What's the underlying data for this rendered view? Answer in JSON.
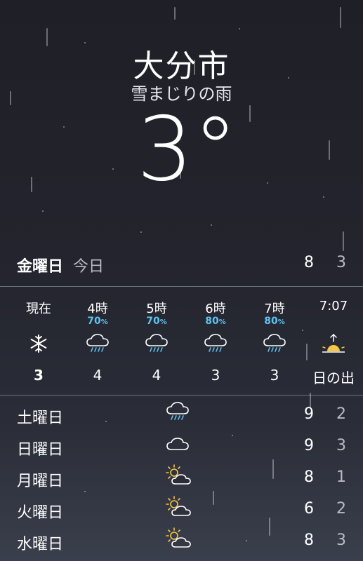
{
  "location": {
    "city": "大分市",
    "condition": "雪まじりの雨",
    "temperature": "3°"
  },
  "today": {
    "day": "金曜日",
    "label": "今日",
    "high": "8",
    "low": "3"
  },
  "hourly": [
    {
      "time": "現在",
      "precip": "",
      "icon": "snowflake-icon",
      "value": "3"
    },
    {
      "time": "4時",
      "precip": "70",
      "icon": "rain-cloud-icon",
      "value": "4"
    },
    {
      "time": "5時",
      "precip": "70",
      "icon": "rain-cloud-icon",
      "value": "4"
    },
    {
      "time": "6時",
      "precip": "80",
      "icon": "rain-cloud-icon",
      "value": "3"
    },
    {
      "time": "7時",
      "precip": "80",
      "icon": "rain-cloud-icon",
      "value": "3"
    },
    {
      "time": "7:07",
      "precip": "",
      "icon": "sunrise-icon",
      "value": "日の出"
    }
  ],
  "precip_unit": "%",
  "daily": [
    {
      "day": "土曜日",
      "icon": "rain-cloud-icon",
      "high": "9",
      "low": "2"
    },
    {
      "day": "日曜日",
      "icon": "cloud-icon",
      "high": "9",
      "low": "3"
    },
    {
      "day": "月曜日",
      "icon": "partly-sunny-icon",
      "high": "8",
      "low": "1"
    },
    {
      "day": "火曜日",
      "icon": "partly-sunny-icon",
      "high": "6",
      "low": "2"
    },
    {
      "day": "水曜日",
      "icon": "partly-sunny-icon",
      "high": "8",
      "low": "3"
    }
  ],
  "colors": {
    "precip": "#5fc3f2",
    "sun": "#f6c644",
    "muted": "#b9bcc6"
  }
}
